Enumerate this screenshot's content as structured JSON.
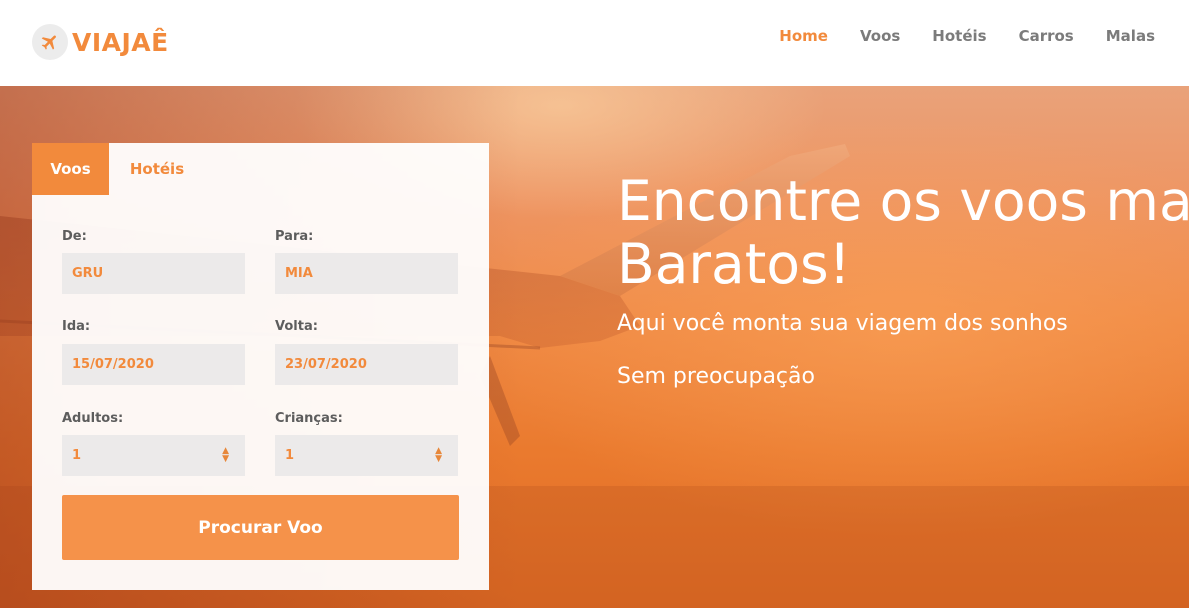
{
  "header": {
    "logo_icon": "plane-icon",
    "logo_text": "VIAJAÊ",
    "nav": [
      {
        "label": "Home",
        "active": true
      },
      {
        "label": "Voos",
        "active": false
      },
      {
        "label": "Hotéis",
        "active": false
      },
      {
        "label": "Carros",
        "active": false
      },
      {
        "label": "Malas",
        "active": false
      }
    ]
  },
  "search": {
    "tabs": [
      {
        "label": "Voos",
        "active": true
      },
      {
        "label": "Hotéis",
        "active": false
      }
    ],
    "from_label": "De:",
    "from_value": "GRU",
    "to_label": "Para:",
    "to_value": "MIA",
    "depart_label": "Ida:",
    "depart_value": "15/07/2020",
    "return_label": "Volta:",
    "return_value": "23/07/2020",
    "adults_label": "Adultos:",
    "adults_value": "1",
    "children_label": "Crianças:",
    "children_value": "1",
    "submit_label": "Procurar Voo"
  },
  "hero": {
    "headline_line1": "Encontre os voos mais",
    "headline_line2": "Baratos!",
    "subtitle": "Aqui você monta sua viagem dos sonhos",
    "tagline": "Sem preocupação"
  },
  "colors": {
    "accent": "#f28a3c",
    "button": "#f5924a",
    "field_bg": "#eceaea"
  }
}
